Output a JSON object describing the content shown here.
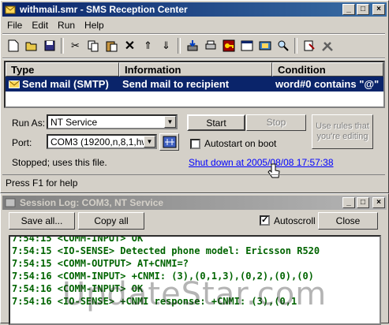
{
  "main_window": {
    "title": "withmail.smr - SMS Reception Center",
    "menu": [
      "File",
      "Edit",
      "Run",
      "Help"
    ]
  },
  "toolbar": {
    "icons": [
      "new-icon",
      "open-icon",
      "save-icon",
      "cut-icon",
      "copy-icon",
      "paste-icon",
      "delete-icon",
      "move-up-icon",
      "move-down-icon",
      "import-icon",
      "print-icon",
      "key-icon",
      "window-icon",
      "settings-icon",
      "find-icon",
      "properties-icon",
      "tools-icon"
    ]
  },
  "rules_table": {
    "columns": [
      "Type",
      "Information",
      "Condition"
    ],
    "rows": [
      {
        "type": "Send mail (SMTP)",
        "information": "Send mail to recipient",
        "condition": "word#0 contains \"@\""
      }
    ]
  },
  "controls": {
    "run_as_label": "Run As:",
    "run_as_value": "NT Service",
    "port_label": "Port:",
    "port_value": "COM3 (19200,n,8,1,hw)",
    "start_label": "Start",
    "stop_label": "Stop",
    "use_rules_label": "Use rules that you're editing",
    "autostart_label": "Autostart on boot",
    "status_text": "Stopped;  uses this file.",
    "shutdown_link": "Shut down at 2005/08/08 17:57:38"
  },
  "statusbar": {
    "text": "Press F1 for help"
  },
  "log_window": {
    "title": "Session Log: COM3, NT Service",
    "save_all_label": "Save all...",
    "copy_all_label": "Copy all",
    "autoscroll_label": "Autoscroll",
    "autoscroll_checked": true,
    "close_label": "Close",
    "lines": [
      "7:54:15 <COMM-INPUT> OK",
      "7:54:15 <IO-SENSE> Detected phone model: Ericsson R520",
      "7:54:15 <COMM-OUTPUT> AT+CNMI=?",
      "7:54:16 <COMM-INPUT> +CNMI: (3),(0,1,3),(0,2),(0),(0)",
      "7:54:16 <COMM-INPUT> OK",
      "7:54:16 <IO-SENSE> +CNMI response: +CNMI: (3),(0,1"
    ]
  },
  "watermark": {
    "text": "UpdateStar.com"
  }
}
